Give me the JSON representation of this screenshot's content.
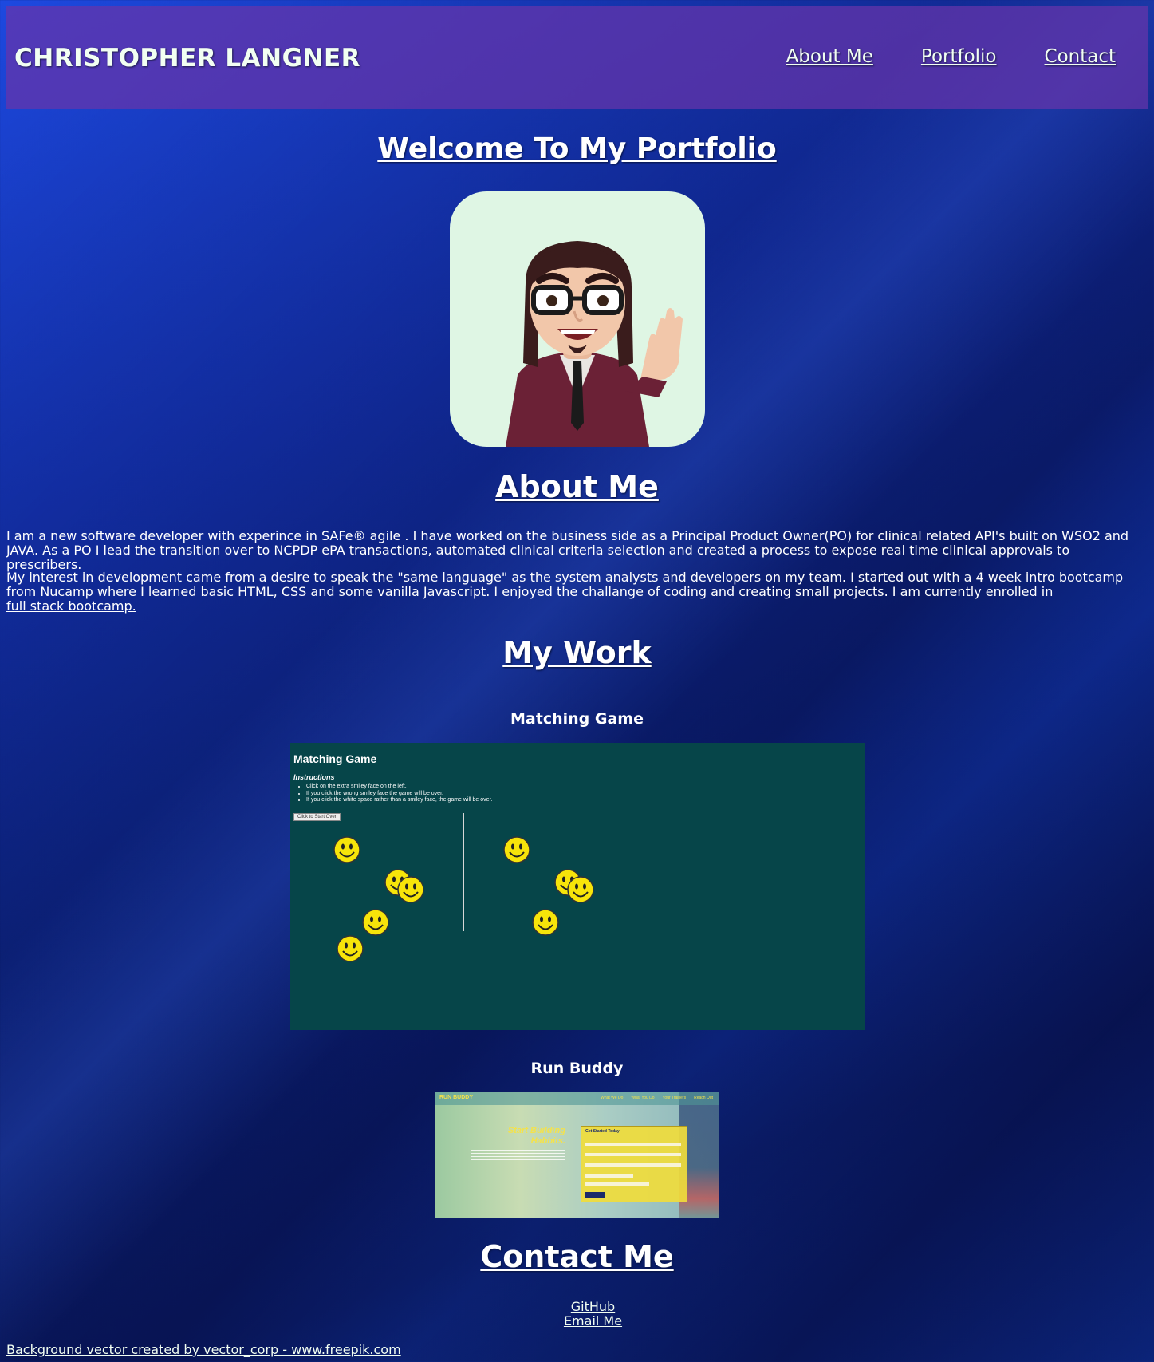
{
  "header": {
    "brand": "CHRISTOPHER LANGNER",
    "nav": [
      {
        "label": "About Me"
      },
      {
        "label": "Portfolio"
      },
      {
        "label": "Contact"
      }
    ]
  },
  "welcome": {
    "title": "Welcome To My Portfolio"
  },
  "about": {
    "title": "About Me",
    "paragraph1": "I am a new software developer with experince in SAFe® agile . I have worked on the business side as a Principal Product Owner(PO) for clinical related API's built on WSO2 and JAVA. As a PO I lead the transition over to NCPDP ePA transactions, automated clinical criteria selection and created a process to expose real time clinical approvals to prescribers.",
    "paragraph2": "My interest in development came from a desire to speak the \"same language\" as the system analysts and developers on my team. I started out with a 4 week intro bootcamp from Nucamp where I learned basic HTML, CSS and some vanilla Javascript. I enjoyed the challange of coding and creating small projects. I am currently enrolled in",
    "bootcamp_link": "full stack bootcamp."
  },
  "work": {
    "title": "My Work",
    "projects": [
      {
        "name": "Matching Game",
        "screenshot": {
          "title": "Matching Game",
          "instructions_label": "Instructions",
          "instructions": [
            "Click on the extra smiley face on the left.",
            "If you click the wrong smiley face the game will be over.",
            "If you click the white space rather than a smiley face, the game will be over."
          ],
          "button": "Click to Start Over"
        }
      },
      {
        "name": "Run Buddy",
        "screenshot": {
          "brand": "RUN BUDDY",
          "nav": [
            "What We Do",
            "What You Do",
            "Your Trainers",
            "Reach Out"
          ],
          "hero": "Start Building Habbits.",
          "form_title": "Get Started Today!"
        }
      }
    ]
  },
  "contact": {
    "title": "Contact Me",
    "links": [
      "GitHub",
      "Email Me"
    ]
  },
  "footer": {
    "credit": "Background vector created by vector_corp - www.freepik.com"
  },
  "colors": {
    "header_bg": "#6734aa",
    "game_bg": "#064549",
    "avatar_bg": "#dff6e4",
    "smiley": "#f7e40a"
  }
}
